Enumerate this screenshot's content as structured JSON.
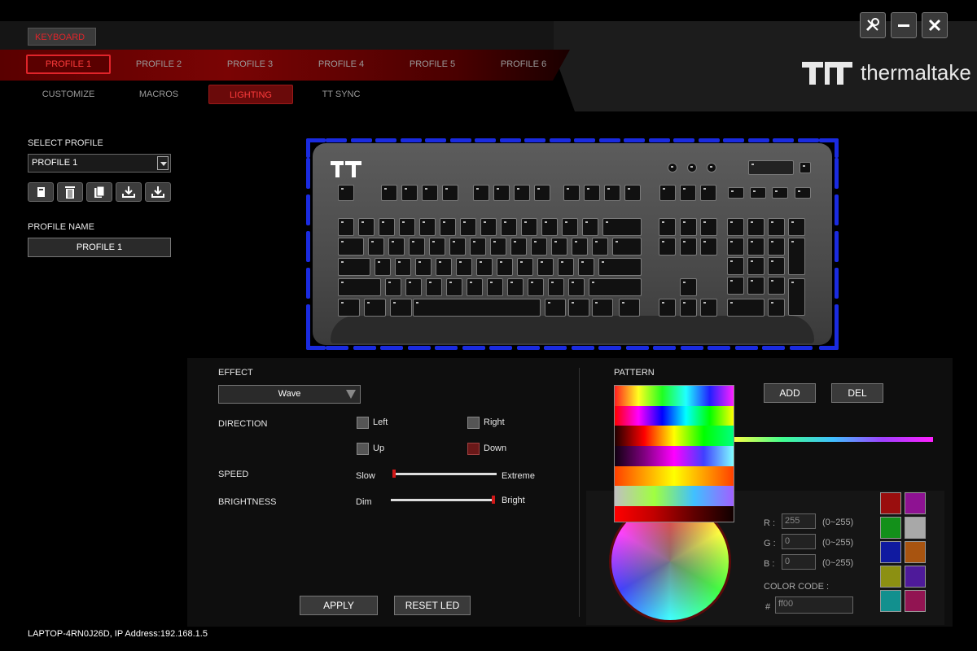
{
  "app": {
    "section_tab": "KEYBOARD",
    "brand": "thermaltake"
  },
  "profiles": [
    "PROFILE 1",
    "PROFILE 2",
    "PROFILE 3",
    "PROFILE 4",
    "PROFILE 5",
    "PROFILE 6"
  ],
  "sub_tabs": [
    "CUSTOMIZE",
    "MACROS",
    "LIGHTING",
    "TT SYNC"
  ],
  "left": {
    "select_profile_label": "SELECT PROFILE",
    "selected_profile": "PROFILE 1",
    "profile_name_label": "PROFILE NAME",
    "profile_name_value": "PROFILE 1"
  },
  "effect": {
    "label": "EFFECT",
    "value": "Wave",
    "direction_label": "DIRECTION",
    "left": "Left",
    "right": "Right",
    "up": "Up",
    "down": "Down",
    "speed_label": "SPEED",
    "speed_min": "Slow",
    "speed_max": "Extreme",
    "speed_value": 0.0,
    "brightness_label": "BRIGHTNESS",
    "brightness_min": "Dim",
    "brightness_max": "Bright",
    "brightness_value": 1.0,
    "apply": "APPLY",
    "reset": "RESET LED"
  },
  "pattern": {
    "label": "PATTERN",
    "add": "ADD",
    "del": "DEL"
  },
  "color": {
    "r_label": "R :",
    "g_label": "G :",
    "b_label": "B :",
    "r_value": "255",
    "g_value": "0",
    "b_value": "0",
    "range_hint": "(0~255)",
    "code_label": "COLOR CODE :",
    "hash": "#",
    "code_value": "ff00",
    "swatches": [
      "#9a0e0e",
      "#8e1292",
      "#13901a",
      "#a8a8a8",
      "#101aa0",
      "#a85410",
      "#8c9012",
      "#4e1a9a",
      "#12908e",
      "#921452"
    ]
  },
  "status": "LAPTOP-4RN0J26D, IP Address:192.168.1.5"
}
